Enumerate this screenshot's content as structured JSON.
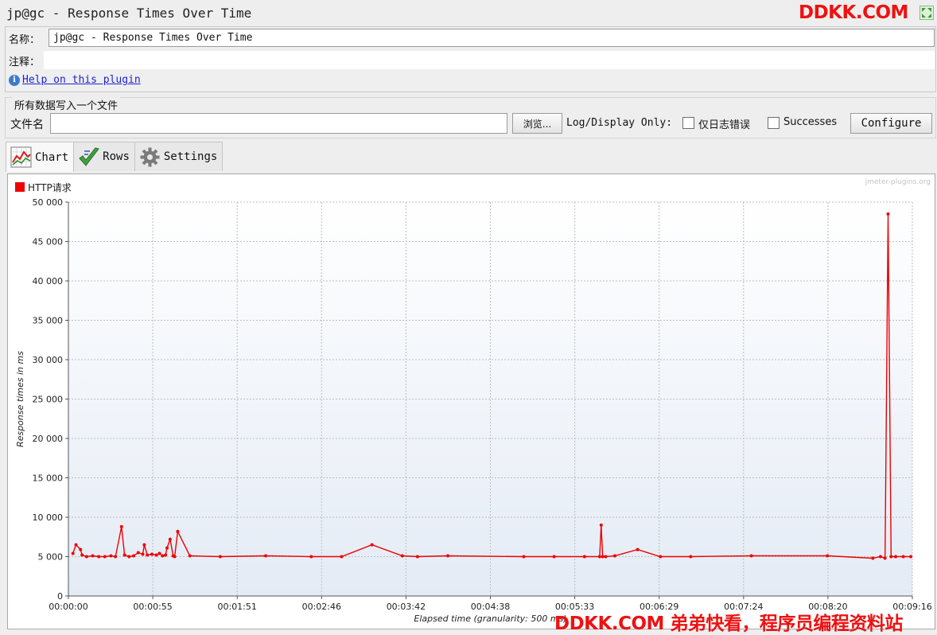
{
  "window": {
    "title": "jp@gc - Response Times Over Time",
    "watermark_top": "DDKK.COM"
  },
  "props": {
    "name_label": "名称：",
    "name_value": "jp@gc - Response Times Over Time",
    "comment_label": "注释：",
    "comment_value": "",
    "help_link": "Help on this plugin"
  },
  "file_section": {
    "title": "所有数据写入一个文件",
    "filename_label": "文件名",
    "filename_value": "",
    "browse_label": "浏览...",
    "log_display_label": "Log/Display Only:",
    "errors_only_label": "仅日志错误",
    "errors_only_checked": false,
    "successes_label": "Successes",
    "successes_checked": false,
    "configure_label": "Configure"
  },
  "tabs": [
    {
      "label": "Chart",
      "icon": "chart-icon",
      "active": true
    },
    {
      "label": "Rows",
      "icon": "checkmark-icon",
      "active": false
    },
    {
      "label": "Settings",
      "icon": "gear-icon",
      "active": false
    }
  ],
  "chart_data": {
    "type": "line",
    "legend": [
      "HTTP请求"
    ],
    "credit": "jmeter-plugins.org",
    "xlabel": "Elapsed time (granularity: 500 ms)",
    "ylabel": "Response times in ms",
    "ylim": [
      0,
      50000
    ],
    "y_ticks": [
      "50 000",
      "45 000",
      "40 000",
      "35 000",
      "30 000",
      "25 000",
      "20 000",
      "15 000",
      "10 000",
      "5 000",
      "0"
    ],
    "xlim_seconds": [
      0,
      556
    ],
    "x_ticks": [
      "00:00:00",
      "00:00:55",
      "00:01:51",
      "00:02:46",
      "00:03:42",
      "00:04:38",
      "00:05:33",
      "00:06:29",
      "00:07:24",
      "00:08:20",
      "00:09:16"
    ],
    "grid": true,
    "legend_position": "top-left",
    "color": "#ee0000",
    "series": [
      {
        "name": "HTTP请求",
        "x_seconds": [
          3,
          5,
          8,
          9,
          12,
          16,
          20,
          24,
          28,
          31,
          35,
          37,
          40,
          43,
          46,
          49,
          50,
          52,
          55,
          58,
          60,
          62,
          64,
          65,
          67,
          69,
          70,
          72,
          80,
          100,
          130,
          160,
          180,
          200,
          220,
          230,
          250,
          300,
          320,
          340,
          350,
          351,
          352,
          354,
          360,
          375,
          390,
          410,
          450,
          500,
          530,
          535,
          538,
          540,
          542,
          545,
          550,
          555
        ],
        "values": [
          5400,
          6500,
          5900,
          5200,
          5000,
          5100,
          5000,
          5000,
          5100,
          5000,
          8800,
          5200,
          5000,
          5100,
          5500,
          5300,
          6500,
          5200,
          5300,
          5200,
          5400,
          5100,
          5200,
          6100,
          7200,
          5100,
          5000,
          8200,
          5100,
          5000,
          5100,
          5000,
          5000,
          6500,
          5100,
          5000,
          5100,
          5000,
          5000,
          5000,
          5000,
          9000,
          5000,
          5000,
          5100,
          5900,
          5000,
          5000,
          5100,
          5100,
          4800,
          5000,
          4800,
          48500,
          5000,
          5000,
          5000,
          5000
        ]
      }
    ]
  },
  "watermark_bottom": "DDKK.COM 弟弟快看，程序员编程资料站"
}
